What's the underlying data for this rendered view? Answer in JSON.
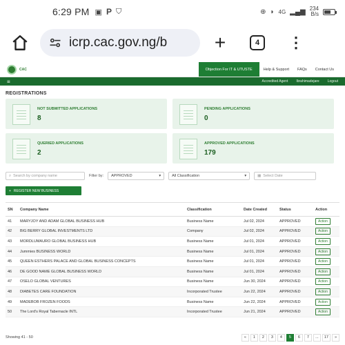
{
  "status_bar": {
    "time": "6:29 PM",
    "speed_value": "234",
    "speed_unit": "B/s"
  },
  "browser": {
    "url": "icrp.cac.gov.ng/b",
    "tab_count": "4"
  },
  "site": {
    "nav": [
      "Objection For IT & UTUSTE",
      "Help & Support",
      "FAQs",
      "Contact Us"
    ],
    "subnav": {
      "accredited_agent": "Accredited Agent",
      "user": "Ibrahimadejare",
      "logout": "Logout"
    }
  },
  "section_title": "REGISTRATIONS",
  "cards": [
    {
      "label": "NOT SUBMITTED APPLICATIONS",
      "value": "8"
    },
    {
      "label": "PENDING APPLICATIONS",
      "value": "0"
    },
    {
      "label": "QUERIED APPLICATIONS",
      "value": "2"
    },
    {
      "label": "APPROVED APPLICATIONS",
      "value": "179"
    }
  ],
  "filters": {
    "search_placeholder": "Search by company name",
    "filter_label": "Filter by:",
    "status_value": "APPROVED",
    "classification_value": "All Classification",
    "date_placeholder": "Select Date"
  },
  "register_button": "REGISTER NEW BUSINESS",
  "table": {
    "headers": [
      "SN",
      "Company Name",
      "Classification",
      "Date Created",
      "Status",
      "Action"
    ],
    "rows": [
      [
        "41",
        "MARYJOY AND ADAM GLOBAL BUSINESS HUB",
        "Business Name",
        "Jul 02, 2024",
        "APPROVED",
        "Action"
      ],
      [
        "42",
        "BIG BERRY GLOBAL INVESTMENTS LTD",
        "Company",
        "Jul 02, 2024",
        "APPROVED",
        "Action"
      ],
      [
        "43",
        "MORDLUMAURO GLOBAL BUSINESS HUB",
        "Business Name",
        "Jul 01, 2024",
        "APPROVED",
        "Action"
      ],
      [
        "44",
        "Jummies BUSINESS WORLD",
        "Business Name",
        "Jul 01, 2024",
        "APPROVED",
        "Action"
      ],
      [
        "45",
        "QUEEN ESTHERS PALACE AND GLOBAL BUSINESS CONCEPTS",
        "Business Name",
        "Jul 01, 2024",
        "APPROVED",
        "Action"
      ],
      [
        "46",
        "DE GOOD NAME GLOBAL BUSINESS WORLD",
        "Business Name",
        "Jul 01, 2024",
        "APPROVED",
        "Action"
      ],
      [
        "47",
        "OSELO GLOBAL VENTURES",
        "Business Name",
        "Jun 30, 2024",
        "APPROVED",
        "Action"
      ],
      [
        "48",
        "DIABETES CARE FOUNDATION",
        "Incorporated Trustee",
        "Jun 22, 2024",
        "APPROVED",
        "Action"
      ],
      [
        "49",
        "MADEBOB FROZEN FOODS",
        "Business Name",
        "Jun 22, 2024",
        "APPROVED",
        "Action"
      ],
      [
        "50",
        "The Lord's Royal Tabernacle INTL",
        "Incorporated Trustee",
        "Jun 21, 2024",
        "APPROVED",
        "Action"
      ]
    ]
  },
  "footer": {
    "showing": "Showing 41 - 50",
    "pages": [
      "«",
      "1",
      "2",
      "3",
      "4",
      "5",
      "6",
      "7",
      "...",
      "17",
      "»"
    ],
    "active_page": "5"
  }
}
